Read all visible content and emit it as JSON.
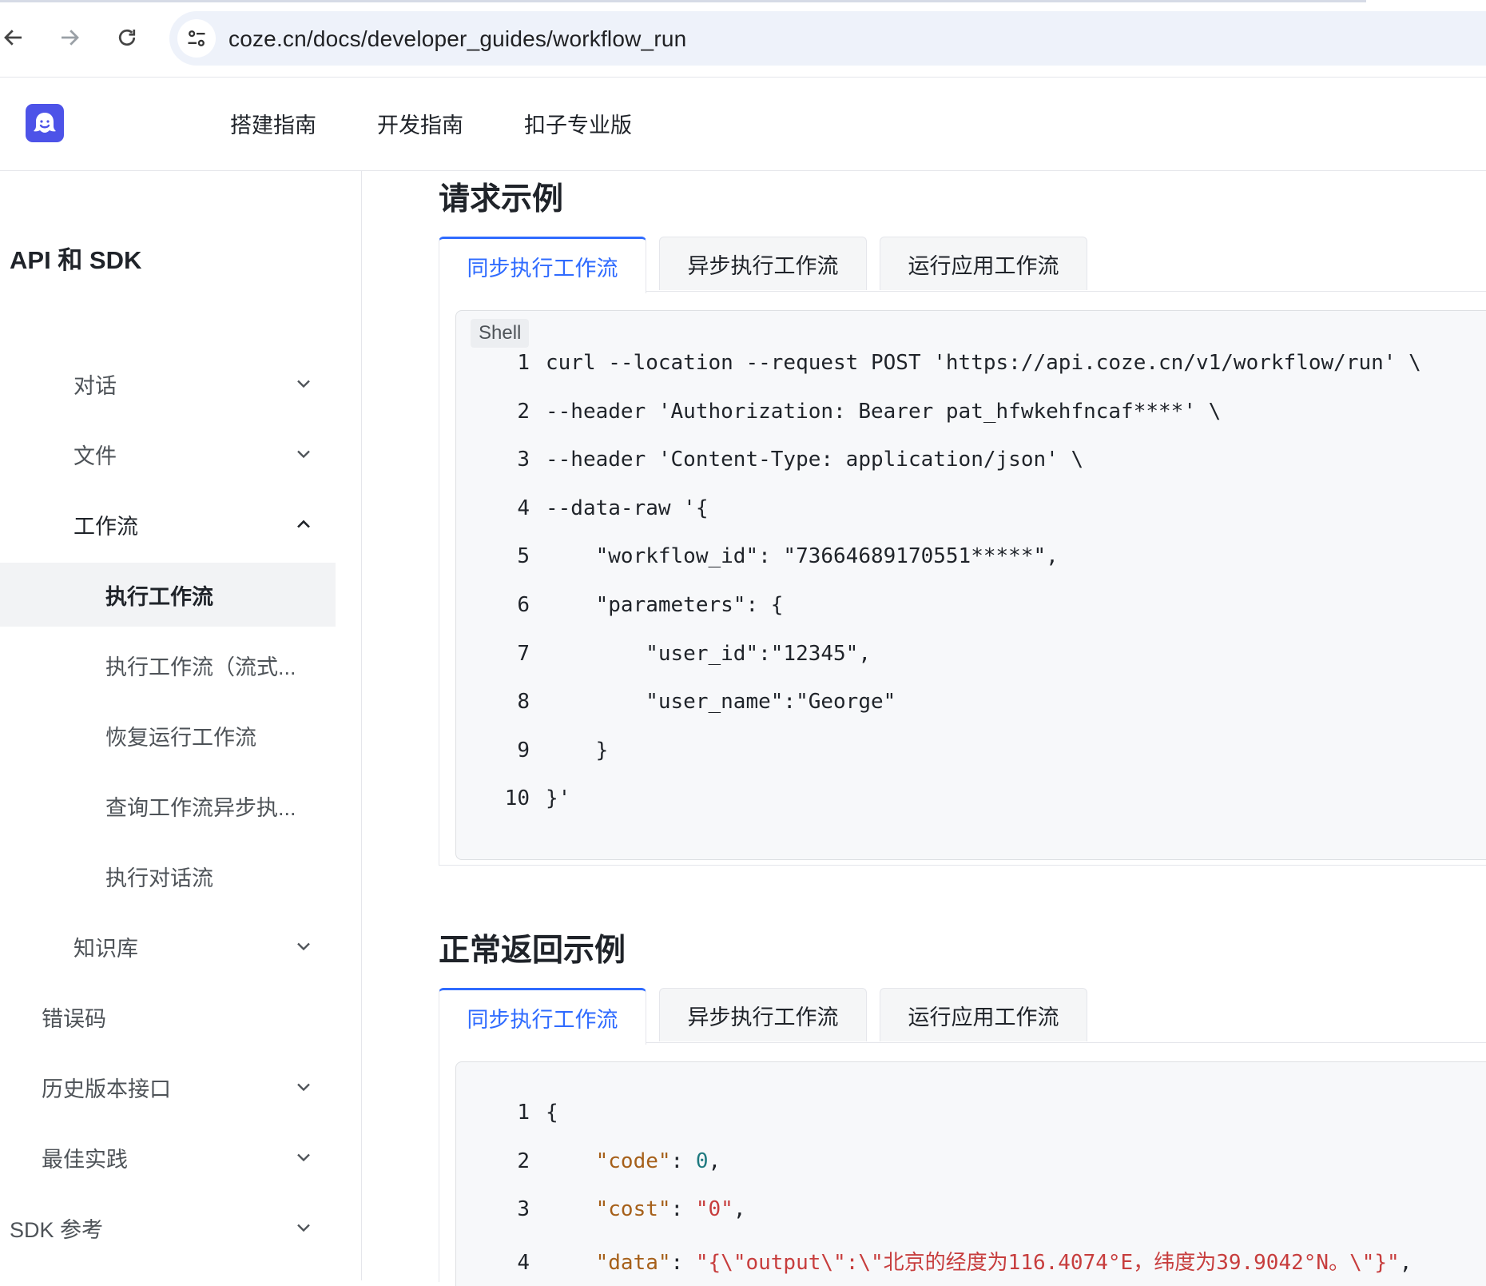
{
  "browser": {
    "url": "coze.cn/docs/developer_guides/workflow_run"
  },
  "header": {
    "nav": [
      "搭建指南",
      "开发指南",
      "扣子专业版"
    ]
  },
  "sidebar": {
    "title": "API 和 SDK",
    "items": [
      {
        "label": "对话",
        "chevron": "chevron-down-icon"
      },
      {
        "label": "文件",
        "chevron": "chevron-down-icon"
      },
      {
        "label": "工作流",
        "chevron": "chevron-up-icon"
      },
      {
        "label": "执行工作流"
      },
      {
        "label": "执行工作流（流式..."
      },
      {
        "label": "恢复运行工作流"
      },
      {
        "label": "查询工作流异步执..."
      },
      {
        "label": "执行对话流"
      },
      {
        "label": "知识库",
        "chevron": "chevron-down-icon"
      },
      {
        "label": "错误码"
      },
      {
        "label": "历史版本接口",
        "chevron": "chevron-down-icon"
      },
      {
        "label": "最佳实践",
        "chevron": "chevron-down-icon"
      },
      {
        "label": "SDK 参考",
        "chevron": "chevron-down-icon"
      }
    ]
  },
  "main": {
    "request_heading": "请求示例",
    "response_heading": "正常返回示例",
    "tabs": [
      "同步执行工作流",
      "异步执行工作流",
      "运行应用工作流"
    ],
    "request_code": {
      "language": "Shell",
      "lines": [
        {
          "n": "1",
          "text": "curl --location --request POST 'https://api.coze.cn/v1/workflow/run' \\"
        },
        {
          "n": "2",
          "text": "--header 'Authorization: Bearer pat_hfwkehfncaf****' \\"
        },
        {
          "n": "3",
          "text": "--header 'Content-Type: application/json' \\"
        },
        {
          "n": "4",
          "text": "--data-raw '{"
        },
        {
          "n": "5",
          "text": "    \"workflow_id\": \"73664689170551*****\","
        },
        {
          "n": "6",
          "text": "    \"parameters\": {"
        },
        {
          "n": "7",
          "text": "        \"user_id\":\"12345\","
        },
        {
          "n": "8",
          "text": "        \"user_name\":\"George\""
        },
        {
          "n": "9",
          "text": "    }"
        },
        {
          "n": "10",
          "text": "}'"
        }
      ]
    },
    "response_code": {
      "lines": [
        {
          "n": "1",
          "indent": "",
          "key": "",
          "sep": "",
          "value": "{",
          "vtype": "plain",
          "tail": ""
        },
        {
          "n": "2",
          "indent": "    ",
          "key": "\"code\"",
          "sep": ": ",
          "value": "0",
          "vtype": "num",
          "tail": ","
        },
        {
          "n": "3",
          "indent": "    ",
          "key": "\"cost\"",
          "sep": ": ",
          "value": "\"0\"",
          "vtype": "str",
          "tail": ","
        },
        {
          "n": "4",
          "indent": "    ",
          "key": "\"data\"",
          "sep": ": ",
          "value": "\"{\\\"output\\\":\\\"北京的经度为116.4074°E，纬度为39.9042°N。\\\"}\"",
          "vtype": "str",
          "tail": ","
        }
      ]
    }
  }
}
